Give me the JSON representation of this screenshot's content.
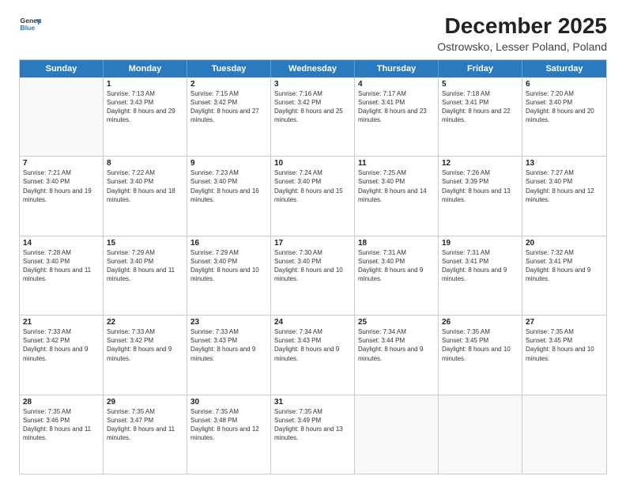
{
  "logo": {
    "line1": "General",
    "line2": "Blue"
  },
  "title": "December 2025",
  "subtitle": "Ostrowsko, Lesser Poland, Poland",
  "days_of_week": [
    "Sunday",
    "Monday",
    "Tuesday",
    "Wednesday",
    "Thursday",
    "Friday",
    "Saturday"
  ],
  "weeks": [
    [
      {
        "day": "",
        "empty": true
      },
      {
        "day": "1",
        "sunrise": "7:13 AM",
        "sunset": "3:43 PM",
        "daylight": "8 hours and 29 minutes."
      },
      {
        "day": "2",
        "sunrise": "7:15 AM",
        "sunset": "3:42 PM",
        "daylight": "8 hours and 27 minutes."
      },
      {
        "day": "3",
        "sunrise": "7:16 AM",
        "sunset": "3:42 PM",
        "daylight": "8 hours and 25 minutes."
      },
      {
        "day": "4",
        "sunrise": "7:17 AM",
        "sunset": "3:41 PM",
        "daylight": "8 hours and 23 minutes."
      },
      {
        "day": "5",
        "sunrise": "7:18 AM",
        "sunset": "3:41 PM",
        "daylight": "8 hours and 22 minutes."
      },
      {
        "day": "6",
        "sunrise": "7:20 AM",
        "sunset": "3:40 PM",
        "daylight": "8 hours and 20 minutes."
      }
    ],
    [
      {
        "day": "7",
        "sunrise": "7:21 AM",
        "sunset": "3:40 PM",
        "daylight": "8 hours and 19 minutes."
      },
      {
        "day": "8",
        "sunrise": "7:22 AM",
        "sunset": "3:40 PM",
        "daylight": "8 hours and 18 minutes."
      },
      {
        "day": "9",
        "sunrise": "7:23 AM",
        "sunset": "3:40 PM",
        "daylight": "8 hours and 16 minutes."
      },
      {
        "day": "10",
        "sunrise": "7:24 AM",
        "sunset": "3:40 PM",
        "daylight": "8 hours and 15 minutes."
      },
      {
        "day": "11",
        "sunrise": "7:25 AM",
        "sunset": "3:40 PM",
        "daylight": "8 hours and 14 minutes."
      },
      {
        "day": "12",
        "sunrise": "7:26 AM",
        "sunset": "3:39 PM",
        "daylight": "8 hours and 13 minutes."
      },
      {
        "day": "13",
        "sunrise": "7:27 AM",
        "sunset": "3:40 PM",
        "daylight": "8 hours and 12 minutes."
      }
    ],
    [
      {
        "day": "14",
        "sunrise": "7:28 AM",
        "sunset": "3:40 PM",
        "daylight": "8 hours and 11 minutes."
      },
      {
        "day": "15",
        "sunrise": "7:29 AM",
        "sunset": "3:40 PM",
        "daylight": "8 hours and 11 minutes."
      },
      {
        "day": "16",
        "sunrise": "7:29 AM",
        "sunset": "3:40 PM",
        "daylight": "8 hours and 10 minutes."
      },
      {
        "day": "17",
        "sunrise": "7:30 AM",
        "sunset": "3:40 PM",
        "daylight": "8 hours and 10 minutes."
      },
      {
        "day": "18",
        "sunrise": "7:31 AM",
        "sunset": "3:40 PM",
        "daylight": "8 hours and 9 minutes."
      },
      {
        "day": "19",
        "sunrise": "7:31 AM",
        "sunset": "3:41 PM",
        "daylight": "8 hours and 9 minutes."
      },
      {
        "day": "20",
        "sunrise": "7:32 AM",
        "sunset": "3:41 PM",
        "daylight": "8 hours and 9 minutes."
      }
    ],
    [
      {
        "day": "21",
        "sunrise": "7:33 AM",
        "sunset": "3:42 PM",
        "daylight": "8 hours and 9 minutes."
      },
      {
        "day": "22",
        "sunrise": "7:33 AM",
        "sunset": "3:42 PM",
        "daylight": "8 hours and 9 minutes."
      },
      {
        "day": "23",
        "sunrise": "7:33 AM",
        "sunset": "3:43 PM",
        "daylight": "8 hours and 9 minutes."
      },
      {
        "day": "24",
        "sunrise": "7:34 AM",
        "sunset": "3:43 PM",
        "daylight": "8 hours and 9 minutes."
      },
      {
        "day": "25",
        "sunrise": "7:34 AM",
        "sunset": "3:44 PM",
        "daylight": "8 hours and 9 minutes."
      },
      {
        "day": "26",
        "sunrise": "7:35 AM",
        "sunset": "3:45 PM",
        "daylight": "8 hours and 10 minutes."
      },
      {
        "day": "27",
        "sunrise": "7:35 AM",
        "sunset": "3:45 PM",
        "daylight": "8 hours and 10 minutes."
      }
    ],
    [
      {
        "day": "28",
        "sunrise": "7:35 AM",
        "sunset": "3:46 PM",
        "daylight": "8 hours and 11 minutes."
      },
      {
        "day": "29",
        "sunrise": "7:35 AM",
        "sunset": "3:47 PM",
        "daylight": "8 hours and 11 minutes."
      },
      {
        "day": "30",
        "sunrise": "7:35 AM",
        "sunset": "3:48 PM",
        "daylight": "8 hours and 12 minutes."
      },
      {
        "day": "31",
        "sunrise": "7:35 AM",
        "sunset": "3:49 PM",
        "daylight": "8 hours and 13 minutes."
      },
      {
        "day": "",
        "empty": true
      },
      {
        "day": "",
        "empty": true
      },
      {
        "day": "",
        "empty": true
      }
    ]
  ]
}
